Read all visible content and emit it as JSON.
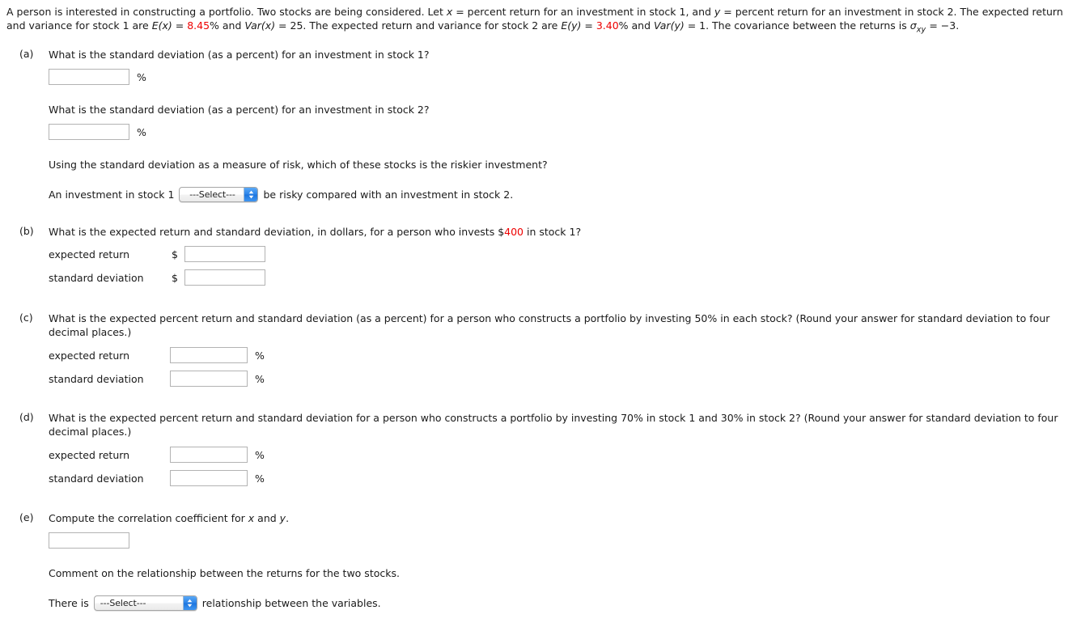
{
  "intro": {
    "s1": "A person is interested in constructing a portfolio. Two stocks are being considered. Let ",
    "x1": "x",
    "s2": " = percent return for an investment in stock 1, and ",
    "y1": "y",
    "s3": " = percent return for an investment in stock 2. The expected return and variance for stock 1 are ",
    "ex_label": "E(x)",
    "eq1": " = ",
    "ex_value": "8.45",
    "s4": "% and ",
    "varx_label": "Var(x)",
    "eq2": " = ",
    "varx_value": "25",
    "s5": ". The expected return and variance for stock 2 are ",
    "ey_label": "E(y)",
    "eq3": " = ",
    "ey_value": "3.40",
    "s6": "% and ",
    "vary_label": "Var(y)",
    "eq4": " = ",
    "vary_value": "1",
    "s7": ". The covariance between the returns is ",
    "sigma_symbol": "σ",
    "sigma_sub": "xy",
    "sigma_eq": " = −3."
  },
  "parts": {
    "a": {
      "label": "(a)",
      "q1": "What is the standard deviation (as a percent) for an investment in stock 1?",
      "q2": "What is the standard deviation (as a percent) for an investment in stock 2?",
      "q3": "Using the standard deviation as a measure of risk, which of these stocks is the riskier investment?",
      "input1_value": "",
      "input2_value": "",
      "unit": "%",
      "sentence_pre": "An investment in stock 1",
      "select_value": "---Select---",
      "sentence_post": "be risky compared with an investment in stock 2."
    },
    "b": {
      "label": "(b)",
      "q_pre": "What is the expected return and standard deviation, in dollars, for a person who invests $",
      "q_amount": "400",
      "q_post": " in stock 1?",
      "row1_label": "expected return",
      "row2_label": "standard deviation",
      "currency": "$",
      "input1_value": "",
      "input2_value": ""
    },
    "c": {
      "label": "(c)",
      "q": "What is the expected percent return and standard deviation (as a percent) for a person who constructs a portfolio by investing 50% in each stock? (Round your answer for standard deviation to four decimal places.)",
      "row1_label": "expected return",
      "row2_label": "standard deviation",
      "unit": "%",
      "input1_value": "",
      "input2_value": ""
    },
    "d": {
      "label": "(d)",
      "q": "What is the expected percent return and standard deviation for a person who constructs a portfolio by investing 70% in stock 1 and 30% in stock 2? (Round your answer for standard deviation to four decimal places.)",
      "row1_label": "expected return",
      "row2_label": "standard deviation",
      "unit": "%",
      "input1_value": "",
      "input2_value": ""
    },
    "e": {
      "label": "(e)",
      "q_pre": "Compute the correlation coefficient for ",
      "q_x": "x",
      "q_mid": " and ",
      "q_y": "y",
      "q_end": ".",
      "input_value": "",
      "comment": "Comment on the relationship between the returns for the two stocks.",
      "sentence_pre": "There is",
      "select_value": "---Select---",
      "sentence_post": "relationship between the variables."
    }
  },
  "colors": {
    "highlight": "#ee0000",
    "text": "#1a1a1a",
    "input_border": "#b3b3b3",
    "select_button": "#2b83e8"
  }
}
